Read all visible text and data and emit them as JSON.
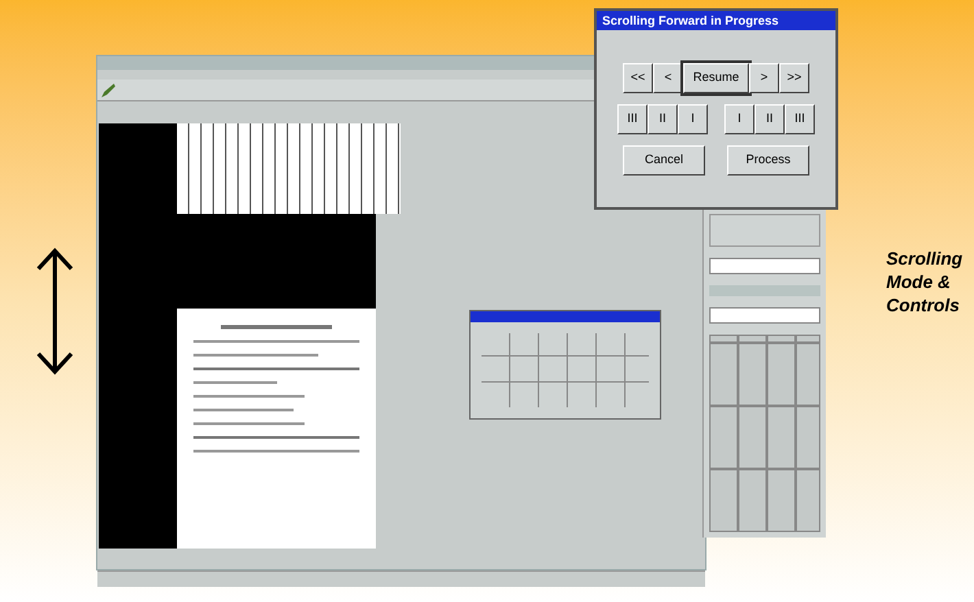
{
  "dialog": {
    "title": "Scrolling Forward in Progress",
    "nav_buttons": [
      {
        "label": "<<",
        "default": false
      },
      {
        "label": "<",
        "default": false
      },
      {
        "label": "Resume",
        "default": true
      },
      {
        "label": ">",
        "default": false
      },
      {
        "label": ">>",
        "default": false
      }
    ],
    "step_back_buttons": [
      {
        "label": "III"
      },
      {
        "label": "II"
      },
      {
        "label": "I"
      }
    ],
    "step_forward_buttons": [
      {
        "label": "I"
      },
      {
        "label": "II"
      },
      {
        "label": "III"
      }
    ],
    "action_buttons": [
      {
        "label": "Cancel"
      },
      {
        "label": "Process"
      }
    ]
  },
  "caption": "Scrolling Mode & Controls"
}
